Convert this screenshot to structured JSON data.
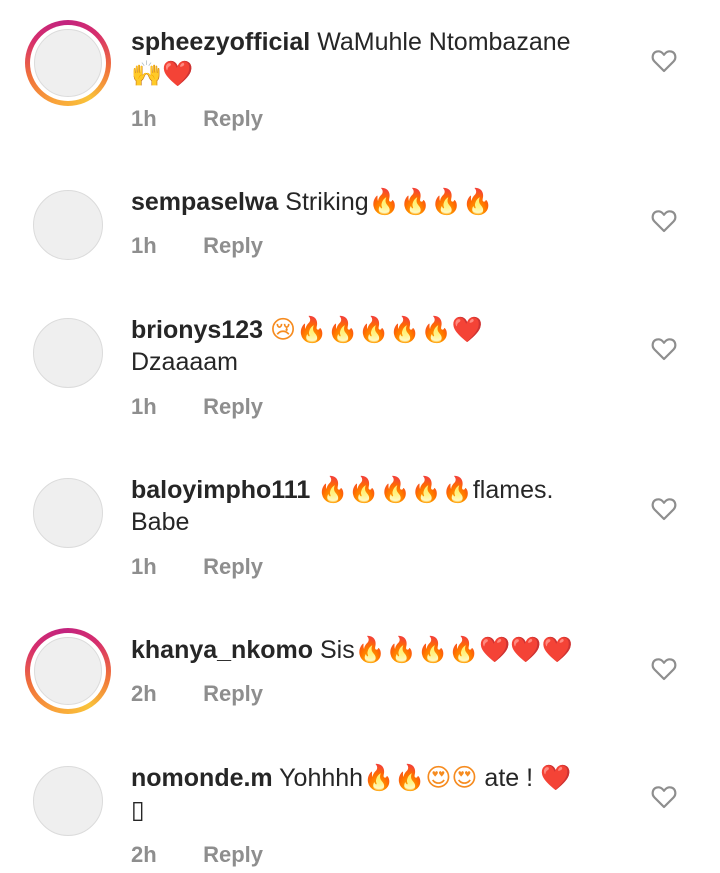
{
  "comments": [
    {
      "username": "spheezyofficial",
      "text": "WaMuhle Ntombazane",
      "emoji_line": "🙌❤️",
      "time": "1h",
      "reply": "Reply"
    },
    {
      "username": "sempaselwa",
      "text": "Striking",
      "emoji": "🔥🔥🔥🔥",
      "time": "1h",
      "reply": "Reply"
    },
    {
      "username": "brionys123",
      "emoji": "😢🔥🔥🔥🔥🔥❤️",
      "second_line": "Dzaaaam",
      "time": "1h",
      "reply": "Reply"
    },
    {
      "username": "baloyimpho111",
      "emoji": "🔥🔥🔥🔥🔥",
      "text_after": "flames.",
      "second_line": "Babe",
      "time": "1h",
      "reply": "Reply"
    },
    {
      "username": "khanya_nkomo",
      "text": "Sis",
      "emoji": "🔥🔥🔥🔥❤️❤️❤️",
      "time": "2h",
      "reply": "Reply"
    },
    {
      "username": "nomonde.m",
      "text": "Yohhhh",
      "emoji": "🔥🔥😍😍",
      "text_after": "ate !",
      "emoji_after": "❤️",
      "second_line": "▯",
      "time": "2h",
      "reply": "Reply"
    }
  ]
}
